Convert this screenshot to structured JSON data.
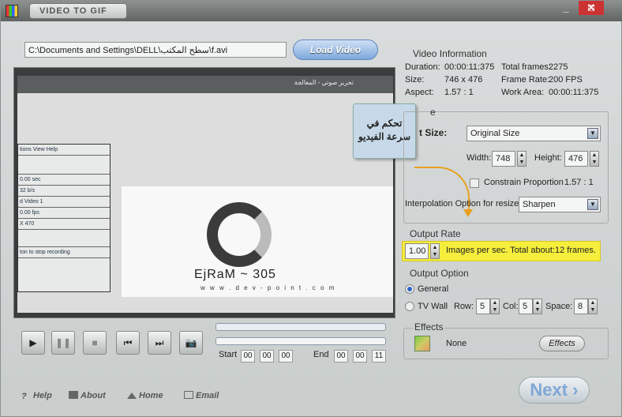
{
  "window": {
    "title": "VIDEO TO GIF",
    "minimize": "_",
    "maximize": "□",
    "close": "✕"
  },
  "file": {
    "path": "C:\\Documents and Settings\\DELL\\سطح المكتب\\f.avi",
    "load_label": "Load Video"
  },
  "preview": {
    "logo_text": "EjRaM ~ 305",
    "logo_url": "w w w . d e v - p o i n t . c o m",
    "inner_title": "تحرير صوتي - المعالجة",
    "side_items": [
      "tions  View  Help",
      "",
      "0.00 sec",
      "32 b/s",
      "d Video 1",
      "0.00 fps",
      "X 470",
      "",
      "ton to stop recording"
    ]
  },
  "tooltip": {
    "text": "تحكم في سرعة الفيديو"
  },
  "playback": {
    "play_icon": "▶",
    "pause_icon": "❚❚",
    "stop_icon": "■",
    "prev_icon": "⏮",
    "next_icon": "⏭",
    "snapshot_icon": "📷",
    "start_label": "Start",
    "start": [
      "00",
      "00",
      "00"
    ],
    "end_label": "End",
    "end": [
      "00",
      "00",
      "11"
    ]
  },
  "video_info": {
    "heading": "Video Information",
    "duration_label": "Duration:",
    "duration": "00:00:11:375",
    "total_frames_label": "Total frames:",
    "total_frames": "2275",
    "size_label": "Size:",
    "size": "746 x 476",
    "frame_rate_label": "Frame Rate:",
    "frame_rate": "200 FPS",
    "aspect_label": "Aspect:",
    "aspect": "1.57 : 1",
    "work_area_label": "Work Area:",
    "work_area": "00:00:11:375"
  },
  "output_size": {
    "heading": "e",
    "size_label": "t Size:",
    "size_value": "Original Size",
    "width_label": "Width:",
    "width": "748",
    "height_label": "Height:",
    "height": "476",
    "constrain_label": "Constrain Proportion",
    "constrain_ratio": "1.57 : 1",
    "interp_label": "Interpolation Option for resize:",
    "interp_value": "Sharpen"
  },
  "output_rate": {
    "heading": "Output Rate",
    "value": "1.00",
    "description": "Images per sec. Total about:12 frames."
  },
  "output_option": {
    "heading": "Output Option",
    "general_label": "General",
    "tvwall_label": "TV Wall",
    "row_label": "Row:",
    "row": "5",
    "col_label": "Col:",
    "col": "5",
    "space_label": "Space:",
    "space": "8"
  },
  "effects": {
    "heading": "Effects",
    "value": "None",
    "button_label": "Effects"
  },
  "footer": {
    "help": "Help",
    "about": "About",
    "home": "Home",
    "email": "Email"
  },
  "next_label": "Next"
}
